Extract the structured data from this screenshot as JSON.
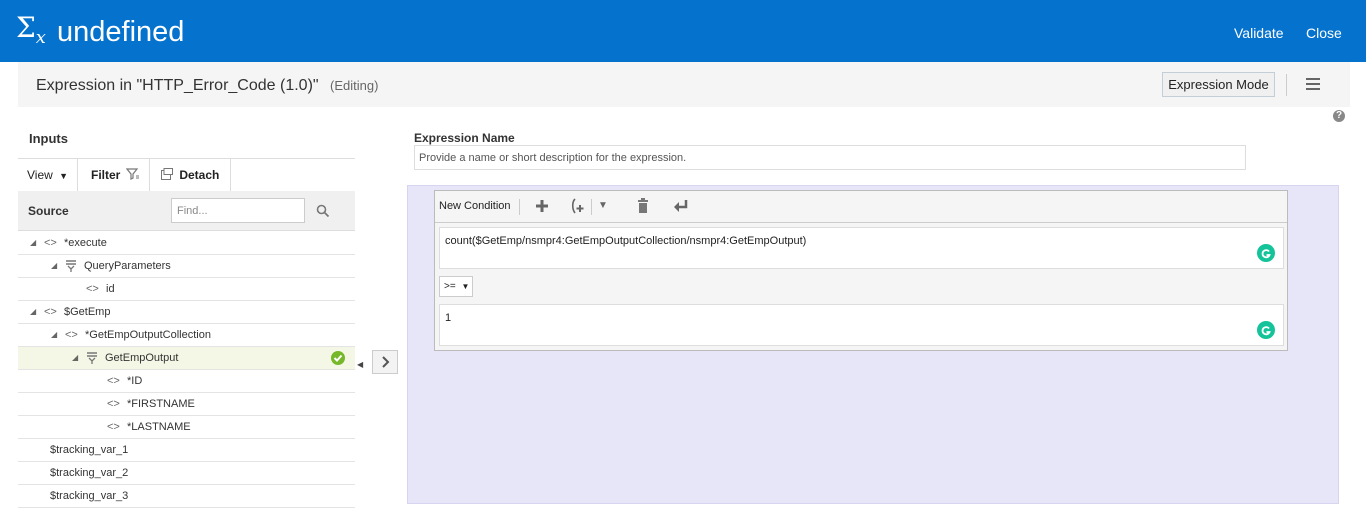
{
  "header": {
    "logo_symbol": "Σ",
    "logo_sub": "x",
    "title": "undefined",
    "validate_label": "Validate",
    "close_label": "Close"
  },
  "subheader": {
    "expression_title": "Expression in \"HTTP_Error_Code (1.0)\"",
    "editing_label": "(Editing)",
    "expression_mode_label": "Expression Mode"
  },
  "inputs": {
    "title": "Inputs",
    "view_label": "View",
    "filter_label": "Filter",
    "detach_label": "Detach",
    "source_label": "Source",
    "find_placeholder": "Find..."
  },
  "tree": [
    {
      "label": "*execute",
      "level": 0,
      "icon": "element-icon",
      "expander": "expanded"
    },
    {
      "label": "QueryParameters",
      "level": 1,
      "icon": "table-icon",
      "expander": "expanded"
    },
    {
      "label": "id",
      "level": 2,
      "icon": "element-icon",
      "expander": "none"
    },
    {
      "label": "$GetEmp",
      "level": 0,
      "icon": "element-icon",
      "expander": "expanded"
    },
    {
      "label": "*GetEmpOutputCollection",
      "level": 1,
      "icon": "element-icon",
      "expander": "expanded"
    },
    {
      "label": "GetEmpOutput",
      "level": 2,
      "icon": "table-icon",
      "expander": "expanded",
      "selected": true
    },
    {
      "label": "*ID",
      "level": 3,
      "icon": "element-icon",
      "expander": "none"
    },
    {
      "label": "*FIRSTNAME",
      "level": 3,
      "icon": "element-icon",
      "expander": "none"
    },
    {
      "label": "*LASTNAME",
      "level": 3,
      "icon": "element-icon",
      "expander": "none"
    },
    {
      "label": "$tracking_var_1",
      "level": 0,
      "icon": "",
      "expander": "none"
    },
    {
      "label": "$tracking_var_2",
      "level": 0,
      "icon": "",
      "expander": "none"
    },
    {
      "label": "$tracking_var_3",
      "level": 0,
      "icon": "",
      "expander": "none"
    }
  ],
  "expression": {
    "name_label": "Expression Name",
    "name_placeholder": "Provide a name or short description for the expression.",
    "new_condition_label": "New Condition",
    "left_operand": "count($GetEmp/nsmpr4:GetEmpOutputCollection/nsmpr4:GetEmpOutput)",
    "operator": ">=",
    "right_operand": "1"
  },
  "colors": {
    "header_bg": "#0572ce",
    "condition_area_bg": "#e7e5f8",
    "selected_check": "#76b82a",
    "grammarly_green": "#15c39a"
  }
}
